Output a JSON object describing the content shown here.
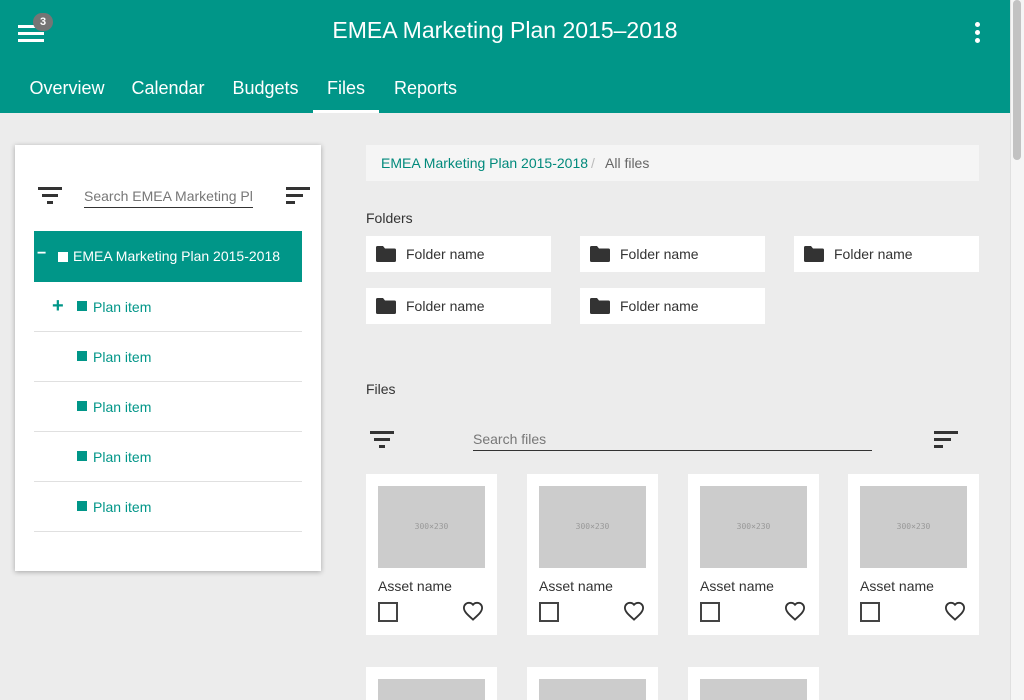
{
  "app": {
    "title": "EMEA Marketing Plan 2015–2018",
    "notification_count": "3",
    "accent_color": "#009688"
  },
  "tabs": [
    {
      "label": "Overview"
    },
    {
      "label": "Calendar"
    },
    {
      "label": "Budgets"
    },
    {
      "label": "Files",
      "active": true
    },
    {
      "label": "Reports"
    }
  ],
  "sidebar": {
    "search_placeholder": "Search EMEA Marketing Plan",
    "root": {
      "toggle": "−",
      "label": "EMEA Marketing Plan 2015-2018"
    },
    "items": [
      {
        "toggle": "+",
        "label": "Plan item"
      },
      {
        "toggle": "",
        "label": "Plan item"
      },
      {
        "toggle": "",
        "label": "Plan item"
      },
      {
        "toggle": "",
        "label": "Plan item"
      },
      {
        "toggle": "",
        "label": "Plan item"
      }
    ]
  },
  "breadcrumb": {
    "link": "EMEA Marketing Plan 2015-2018",
    "separator": "/",
    "current": "All files"
  },
  "folders": {
    "heading": "Folders",
    "items": [
      {
        "label": "Folder name"
      },
      {
        "label": "Folder name"
      },
      {
        "label": "Folder name"
      },
      {
        "label": "Folder name"
      },
      {
        "label": "Folder name"
      }
    ]
  },
  "files": {
    "heading": "Files",
    "search_placeholder": "Search files",
    "assets": [
      {
        "name": "Asset name",
        "placeholder": "300×230"
      },
      {
        "name": "Asset name",
        "placeholder": "300×230"
      },
      {
        "name": "Asset name",
        "placeholder": "300×230"
      },
      {
        "name": "Asset name",
        "placeholder": "300×230"
      }
    ]
  }
}
